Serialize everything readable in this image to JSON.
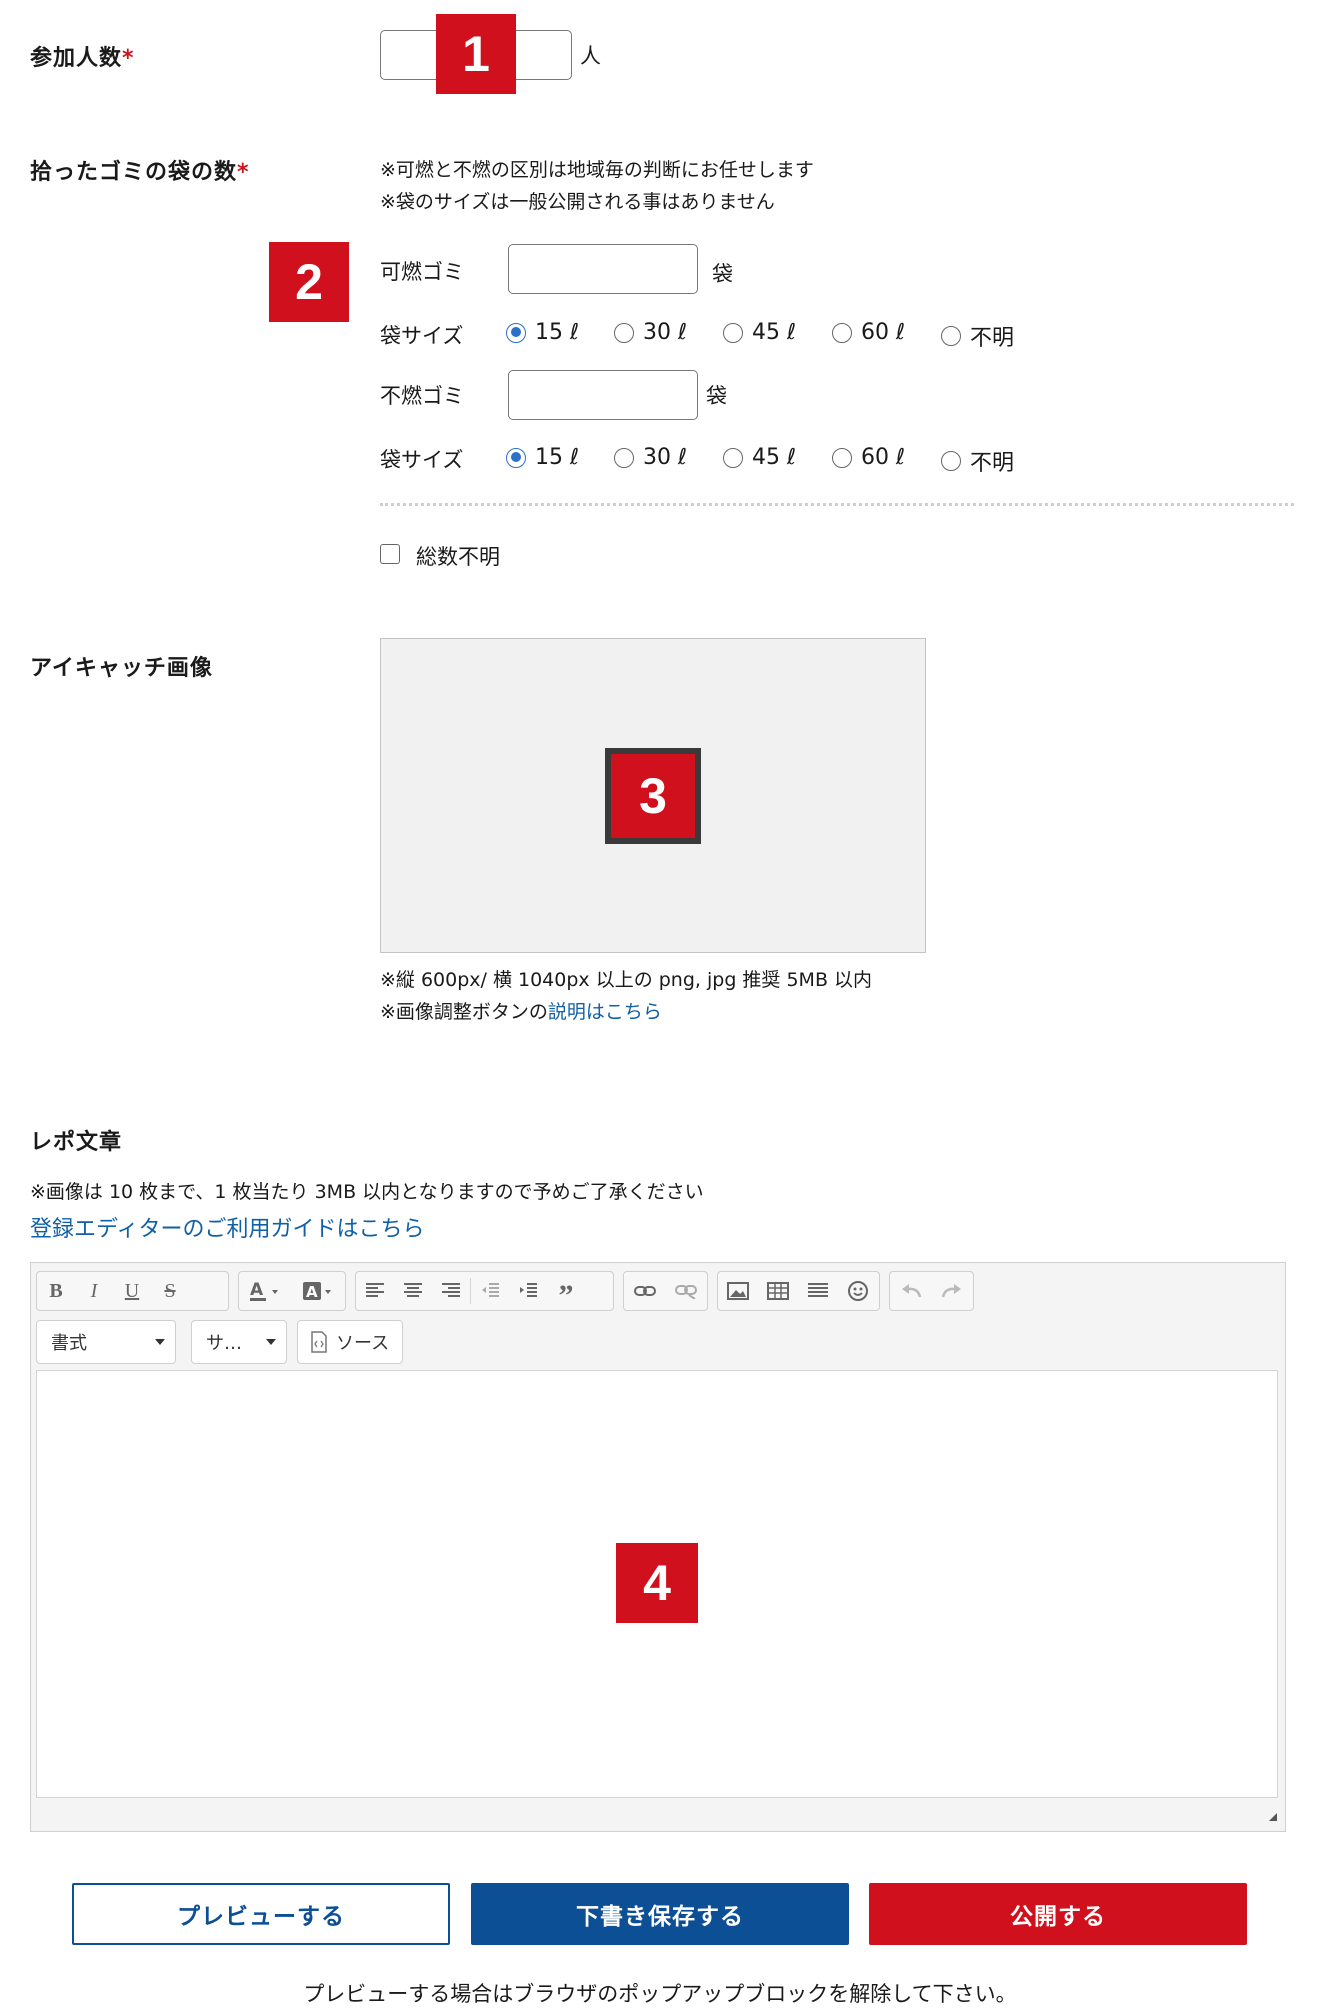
{
  "participants": {
    "label": "参加人数",
    "required_mark": "*",
    "unit": "人",
    "value": "",
    "marker": "1"
  },
  "garbage": {
    "label": "拾ったゴミの袋の数",
    "required_mark": "*",
    "notes": [
      "※可燃と不燃の区別は地域毎の判断にお任せします",
      "※袋のサイズは一般公開される事はありません"
    ],
    "marker": "2",
    "burnable": {
      "label": "可燃ゴミ",
      "unit": "袋",
      "value": ""
    },
    "nonburnable": {
      "label": "不燃ゴミ",
      "unit": "袋",
      "value": ""
    },
    "size_label": "袋サイズ",
    "size_options": [
      "15 ℓ",
      "30 ℓ",
      "45 ℓ",
      "60 ℓ",
      "不明"
    ],
    "burnable_size_selected": "15 ℓ",
    "nonburnable_size_selected": "15 ℓ",
    "unknown_total_label": "総数不明",
    "unknown_total_checked": false
  },
  "eyecatch": {
    "label": "アイキャッチ画像",
    "marker": "3",
    "note1": "※縦 600px/ 横 1040px 以上の png, jpg 推奨 5MB 以内",
    "note2_prefix": "※画像調整ボタンの",
    "note2_link": "説明はこちら"
  },
  "report": {
    "label": "レポ文章",
    "note": "※画像は 10 枚まで、1 枚当たり 3MB 以内となりますので予めご了承ください",
    "guide_link": "登録エディターのご利用ガイドはこちら",
    "marker": "4",
    "editor": {
      "format_select": "書式",
      "size_select": "サ…",
      "source_button": "ソース",
      "toolbar_icons": [
        "bold-icon",
        "italic-icon",
        "underline-icon",
        "strikethrough-icon",
        "text-color-icon",
        "background-color-icon",
        "align-left-icon",
        "align-center-icon",
        "align-right-icon",
        "outdent-icon",
        "indent-icon",
        "blockquote-icon",
        "link-icon",
        "unlink-icon",
        "image-icon",
        "table-icon",
        "horizontal-line-icon",
        "emoji-icon",
        "undo-icon",
        "redo-icon"
      ]
    }
  },
  "actions": {
    "preview": "プレビューする",
    "save_draft": "下書き保存する",
    "publish": "公開する",
    "popup_note": "プレビューする場合はブラウザのポップアップブロックを解除して下さい。"
  },
  "colors": {
    "accent_red": "#d0101c",
    "primary_blue": "#0d4f95",
    "link_blue": "#1060a8",
    "radio_blue": "#2b70c9"
  }
}
